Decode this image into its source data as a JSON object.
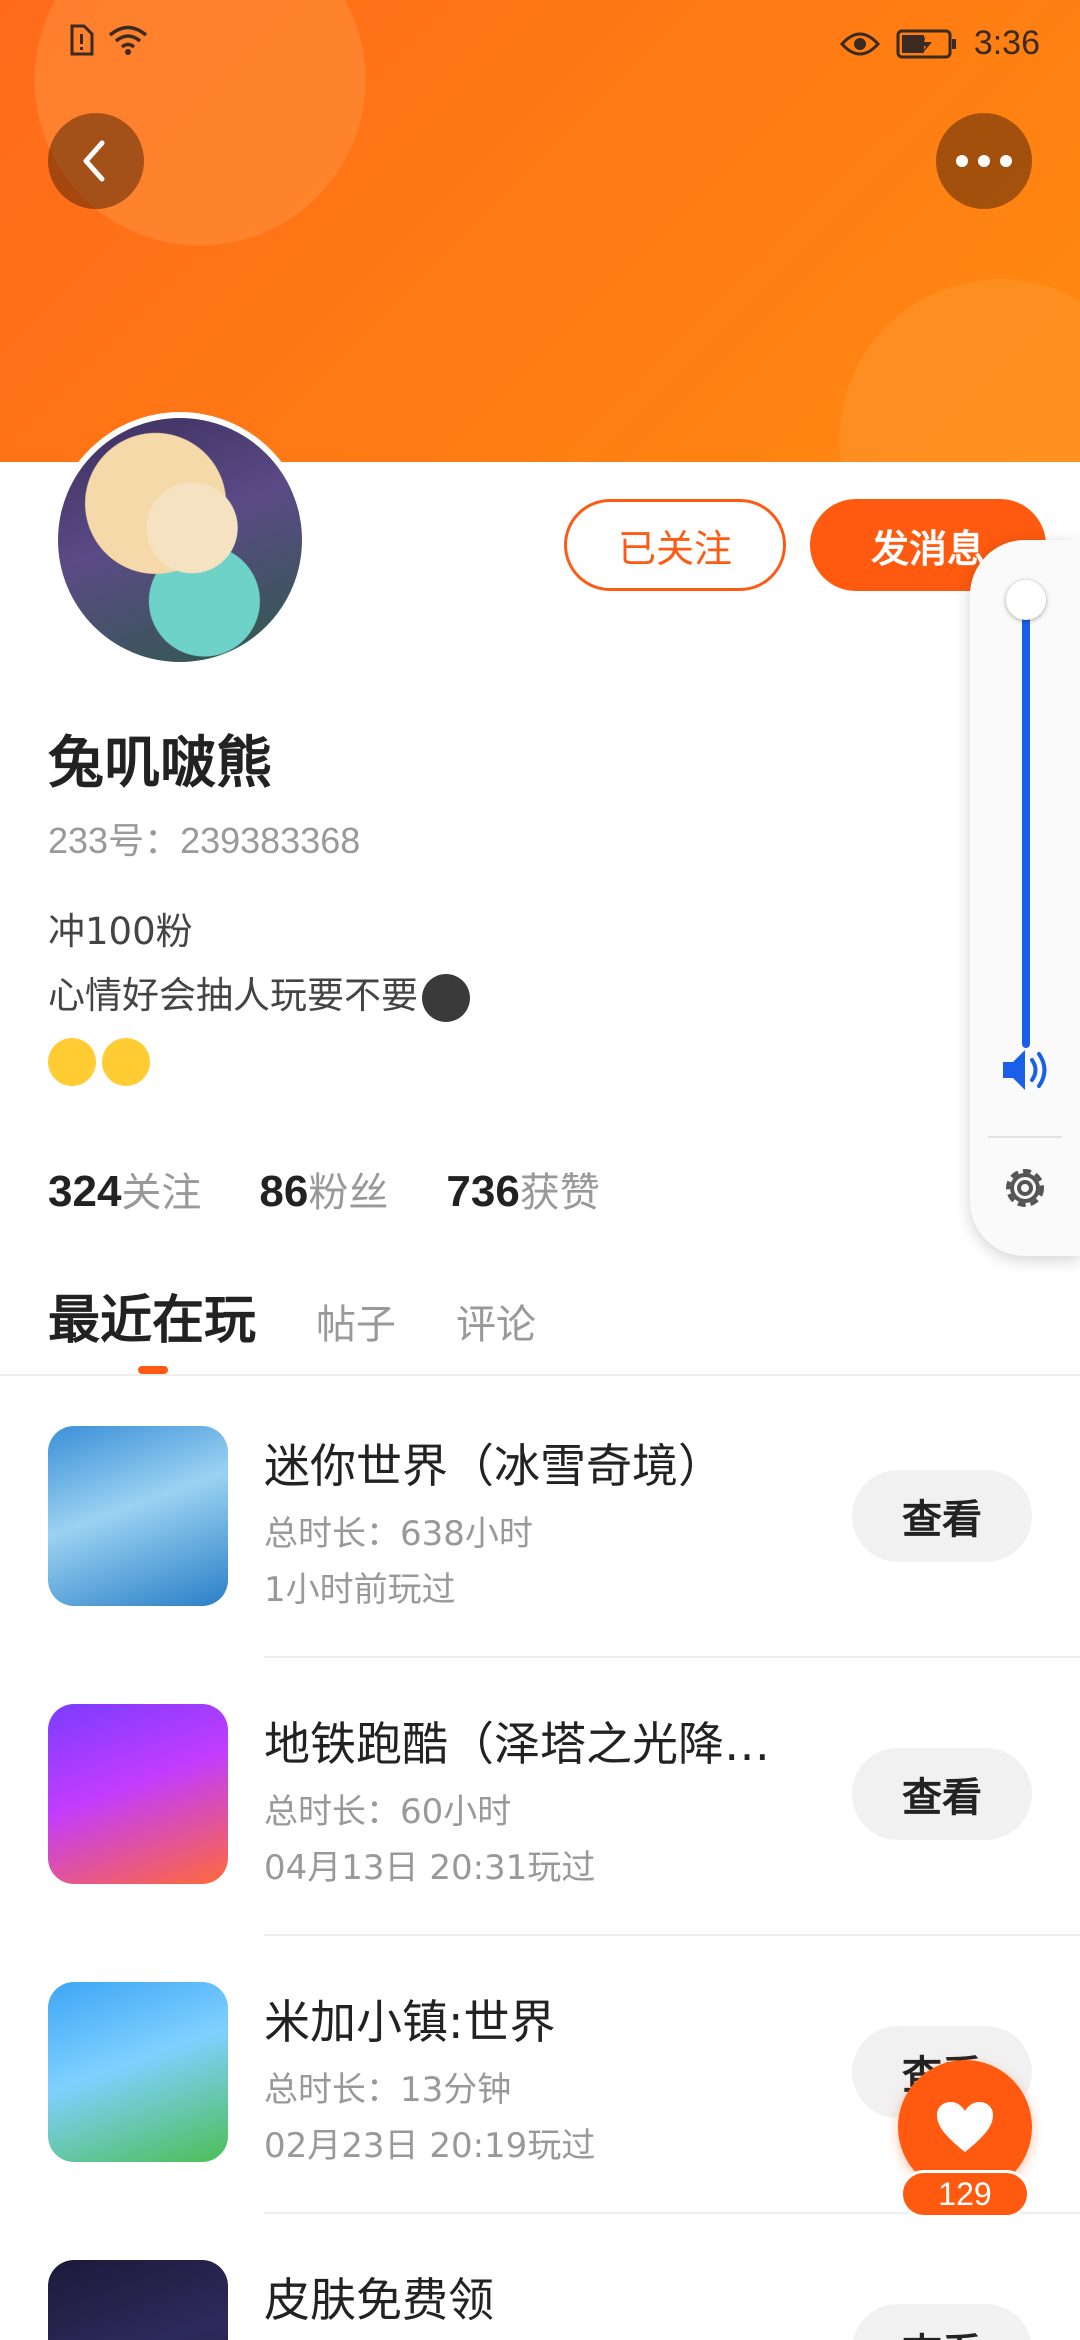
{
  "status_bar": {
    "time": "3:36"
  },
  "profile": {
    "username": "兔叽啵熊",
    "user_id": "233号：239383368",
    "bio_line1": "冲100粉",
    "bio_line2": "心情好会抽人玩要不要"
  },
  "actions": {
    "follow_label": "已关注",
    "message_label": "发消息"
  },
  "stats": [
    {
      "num": "324",
      "label": "关注"
    },
    {
      "num": "86",
      "label": "粉丝"
    },
    {
      "num": "736",
      "label": "获赞"
    }
  ],
  "tabs": [
    "最近在玩",
    "帖子",
    "评论"
  ],
  "games": [
    {
      "title": "迷你世界（冰雪奇境）",
      "duration": "总时长：638小时",
      "last_played": "1小时前玩过",
      "button": "查看",
      "icon": "mini-world-icon"
    },
    {
      "title": "地铁跑酷（泽塔之光降…",
      "duration": "总时长：60小时",
      "last_played": "04月13日 20:31玩过",
      "button": "查看",
      "icon": "subway-surfers-icon"
    },
    {
      "title": "米加小镇:世界",
      "duration": "总时长：13分钟",
      "last_played": "02月23日 20:19玩过",
      "button": "查看",
      "icon": "toca-world-icon"
    },
    {
      "title": "皮肤免费领",
      "duration": "",
      "last_played": "",
      "button": "查看",
      "icon": "skin-free-icon"
    }
  ],
  "like": {
    "count": "129"
  },
  "colors": {
    "accent": "#ff5a0f",
    "volume": "#1a5fe8"
  }
}
